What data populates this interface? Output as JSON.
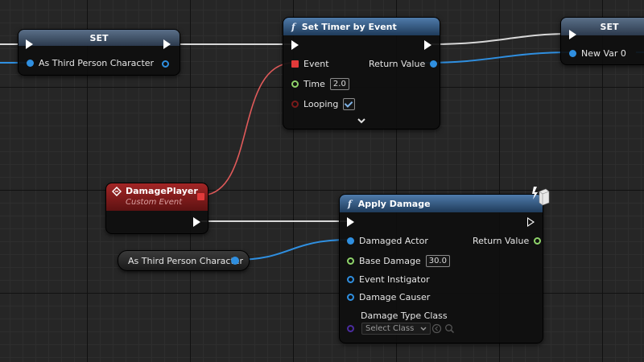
{
  "nodes": {
    "set_left": {
      "title": "SET",
      "pin_label": "As Third Person Character"
    },
    "set_timer": {
      "fn_symbol": "f",
      "title": "Set Timer by Event",
      "event_label": "Event",
      "return_label": "Return Value",
      "time_label": "Time",
      "time_value": "2.0",
      "looping_label": "Looping",
      "looping_checked": true,
      "expand_icon": "chevron-down"
    },
    "set_right": {
      "title": "SET",
      "pin_label": "New Var 0"
    },
    "damage_player": {
      "title": "DamagePlayer",
      "subtitle": "Custom Event"
    },
    "cast_ref": {
      "label": "As Third Person Character"
    },
    "apply_damage": {
      "fn_symbol": "f",
      "title": "Apply Damage",
      "damaged_actor": "Damaged Actor",
      "return_label": "Return Value",
      "base_damage_label": "Base Damage",
      "base_damage_value": "30.0",
      "event_instigator": "Event Instigator",
      "damage_causer": "Damage Causer",
      "damage_type_class": "Damage Type Class",
      "select_class": "Select Class"
    }
  },
  "colors": {
    "exec": "#ffffff",
    "object_pin": "#2f8fe0",
    "float_pin": "#8fd46a",
    "delegate_pin": "#e23a3a",
    "bool_pin": "#7a1a1a",
    "class_pin": "#4b2ca0",
    "event_header": "#8e1f1f"
  }
}
